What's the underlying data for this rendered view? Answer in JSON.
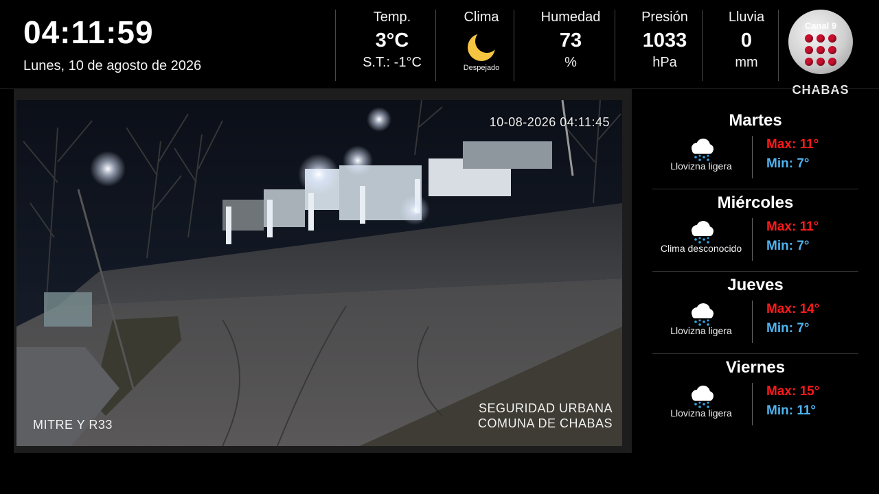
{
  "clock": {
    "time": "04:11:59",
    "date": "Lunes, 10 de agosto de 2026"
  },
  "weather": {
    "temp": {
      "label": "Temp.",
      "value": "3°C",
      "sub": "S.T.: -1°C"
    },
    "clima": {
      "label": "Clima",
      "icon": "moon-icon",
      "desc": "Despejado"
    },
    "humedad": {
      "label": "Humedad",
      "value": "73",
      "unit": "%"
    },
    "presion": {
      "label": "Presión",
      "value": "1033",
      "unit": "hPa"
    },
    "lluvia": {
      "label": "Lluvia",
      "value": "0",
      "unit": "mm"
    }
  },
  "logo": {
    "channel": "Canal 9",
    "brand": "CHABAS"
  },
  "camera": {
    "timestamp": "10-08-2026 04:11:45",
    "location": "MITRE Y R33",
    "org_line1": "SEGURIDAD URBANA",
    "org_line2": "COMUNA DE CHABAS"
  },
  "forecast": [
    {
      "day": "Martes",
      "icon": "rain-cloud-icon",
      "desc": "Llovizna ligera",
      "max": "Max: 11°",
      "min": "Min: 7°"
    },
    {
      "day": "Miércoles",
      "icon": "rain-cloud-icon",
      "desc": "Clima desconocido",
      "max": "Max: 11°",
      "min": "Min: 7°"
    },
    {
      "day": "Jueves",
      "icon": "rain-cloud-icon",
      "desc": "Llovizna ligera",
      "max": "Max: 14°",
      "min": "Min: 7°"
    },
    {
      "day": "Viernes",
      "icon": "rain-cloud-icon",
      "desc": "Llovizna ligera",
      "max": "Max: 15°",
      "min": "Min: 11°"
    }
  ],
  "colors": {
    "max": "#ff1a1a",
    "min": "#4fb4f0",
    "logo_dots": "#c8102e"
  }
}
